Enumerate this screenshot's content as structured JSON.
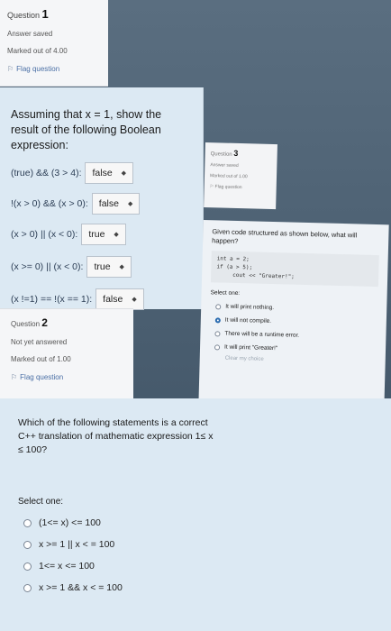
{
  "q1": {
    "number": "1",
    "label": "Question",
    "status": "Answer saved",
    "marks": "Marked out of 4.00",
    "flag": "Flag question",
    "prompt": "Assuming that x = 1, show the result of the following Boolean expression:",
    "rows": [
      {
        "expr": "(true) && (3 > 4):",
        "value": "false"
      },
      {
        "expr": "!(x > 0) && (x > 0):",
        "value": "false"
      },
      {
        "expr": "(x > 0) || (x < 0):",
        "value": "true"
      },
      {
        "expr": "(x >= 0) || (x < 0):",
        "value": "true"
      },
      {
        "expr": "(x !=1) == !(x == 1):",
        "value": "false"
      }
    ]
  },
  "q2": {
    "number": "2",
    "label": "Question",
    "status": "Not yet answered",
    "marks": "Marked out of 1.00",
    "flag": "Flag question",
    "prompt": "Which of the following statements is a correct C++ translation of mathematic expression 1≤ x ≤ 100?",
    "select_one": "Select one:",
    "options": [
      "(1<= x) <= 100",
      "x >= 1 || x < = 100",
      "1<= x <= 100",
      "x >= 1 && x < = 100"
    ]
  },
  "q3": {
    "number": "3",
    "label": "Question",
    "status": "Answer saved",
    "marks": "Marked out of 1.00",
    "flag": "Flag question",
    "prompt": "Given code structured as shown below, what will happen?",
    "code": "int a = 2;\nif (a > 5);\n     cout << \"Greater!\";",
    "select_one": "Select one:",
    "options": [
      "It will print nothing.",
      "It will not compile.",
      "There will be a runtime error.",
      "It will print \"Greater!\""
    ],
    "clear": "Clear my choice"
  },
  "colors": {
    "panel_bg": "#dce9f3",
    "info_bg": "#f5f6f8",
    "selected_radio": "#2b6cb0"
  }
}
